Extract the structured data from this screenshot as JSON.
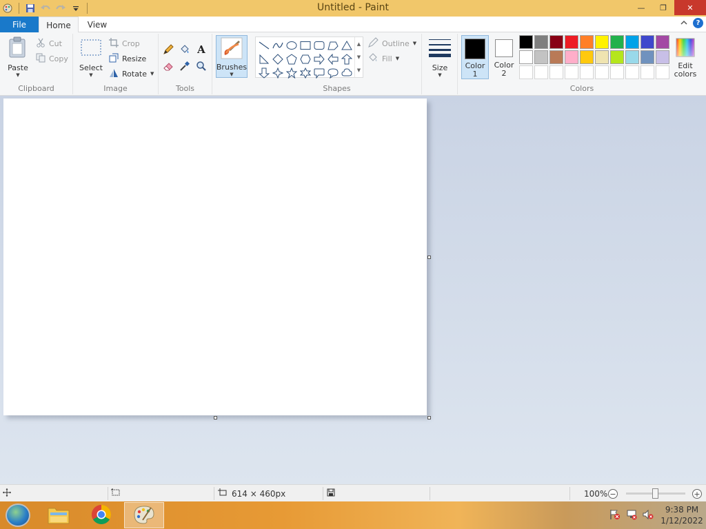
{
  "window": {
    "title": "Untitled - Paint",
    "minimize_glyph": "—",
    "restore_glyph": "❐",
    "close_glyph": "✕"
  },
  "tabs": {
    "file": "File",
    "home": "Home",
    "view": "View",
    "help_glyph": "?"
  },
  "ribbon": {
    "clipboard": {
      "label": "Clipboard",
      "paste": "Paste",
      "cut": "Cut",
      "copy": "Copy"
    },
    "image": {
      "label": "Image",
      "select": "Select",
      "crop": "Crop",
      "resize": "Resize",
      "rotate": "Rotate"
    },
    "tools": {
      "label": "Tools",
      "text_glyph": "A"
    },
    "brushes": {
      "label": "Brushes"
    },
    "shapes": {
      "label": "Shapes",
      "outline": "Outline",
      "fill": "Fill"
    },
    "size": {
      "label": "Size"
    },
    "colors": {
      "label": "Colors",
      "color1_line1": "Color",
      "color1_line2": "1",
      "color2_line1": "Color",
      "color2_line2": "2",
      "edit_line1": "Edit",
      "edit_line2": "colors",
      "color1_value": "#000000",
      "color2_value": "#ffffff",
      "palette_row1": [
        "#000000",
        "#7f7f7f",
        "#880015",
        "#ed1c24",
        "#ff7f27",
        "#fff200",
        "#22b14c",
        "#00a2e8",
        "#3f48cc",
        "#a349a4"
      ],
      "palette_row2": [
        "#ffffff",
        "#c3c3c3",
        "#b97a57",
        "#ffaec9",
        "#ffc90e",
        "#efe4b0",
        "#b5e61d",
        "#99d9ea",
        "#7092be",
        "#c8bfe7"
      ]
    }
  },
  "status": {
    "canvas_size": "614 × 460px",
    "zoom": "100%",
    "zoom_out_glyph": "−",
    "zoom_in_glyph": "+"
  },
  "taskbar": {
    "time": "9:38 PM",
    "date": "1/12/2022"
  }
}
